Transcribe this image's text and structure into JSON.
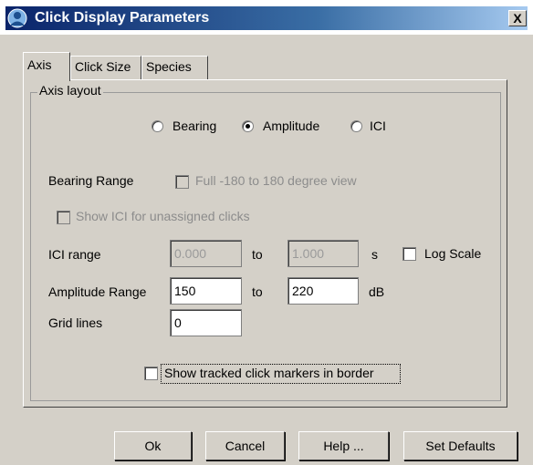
{
  "window": {
    "title": "Click Display Parameters",
    "close_label": "X"
  },
  "tabs": [
    {
      "label": "Axis",
      "active": true
    },
    {
      "label": "Click Size",
      "active": false
    },
    {
      "label": "Species",
      "active": false
    }
  ],
  "axis_layout": {
    "legend": "Axis layout",
    "options": [
      {
        "label": "Bearing",
        "selected": false
      },
      {
        "label": "Amplitude",
        "selected": true
      },
      {
        "label": "ICI",
        "selected": false
      }
    ]
  },
  "bearing_range": {
    "label": "Bearing Range",
    "full_view_label": "Full -180 to 180 degree view",
    "full_view_checked": false,
    "enabled": false
  },
  "show_ici_unassigned": {
    "label": "Show ICI for unassigned clicks",
    "checked": false,
    "enabled": false
  },
  "ici_range": {
    "label": "ICI range",
    "min": "0.000",
    "to_label": "to",
    "max": "1.000",
    "unit": "s",
    "log_scale_label": "Log Scale",
    "log_scale_checked": false
  },
  "amplitude_range": {
    "label": "Amplitude Range",
    "min": "150",
    "to_label": "to",
    "max": "220",
    "unit": "dB"
  },
  "grid_lines": {
    "label": "Grid lines",
    "value": "0"
  },
  "tracked_markers": {
    "label": "Show tracked click markers in border",
    "checked": false
  },
  "buttons": {
    "ok": "Ok",
    "cancel": "Cancel",
    "help": "Help ...",
    "defaults": "Set Defaults"
  }
}
